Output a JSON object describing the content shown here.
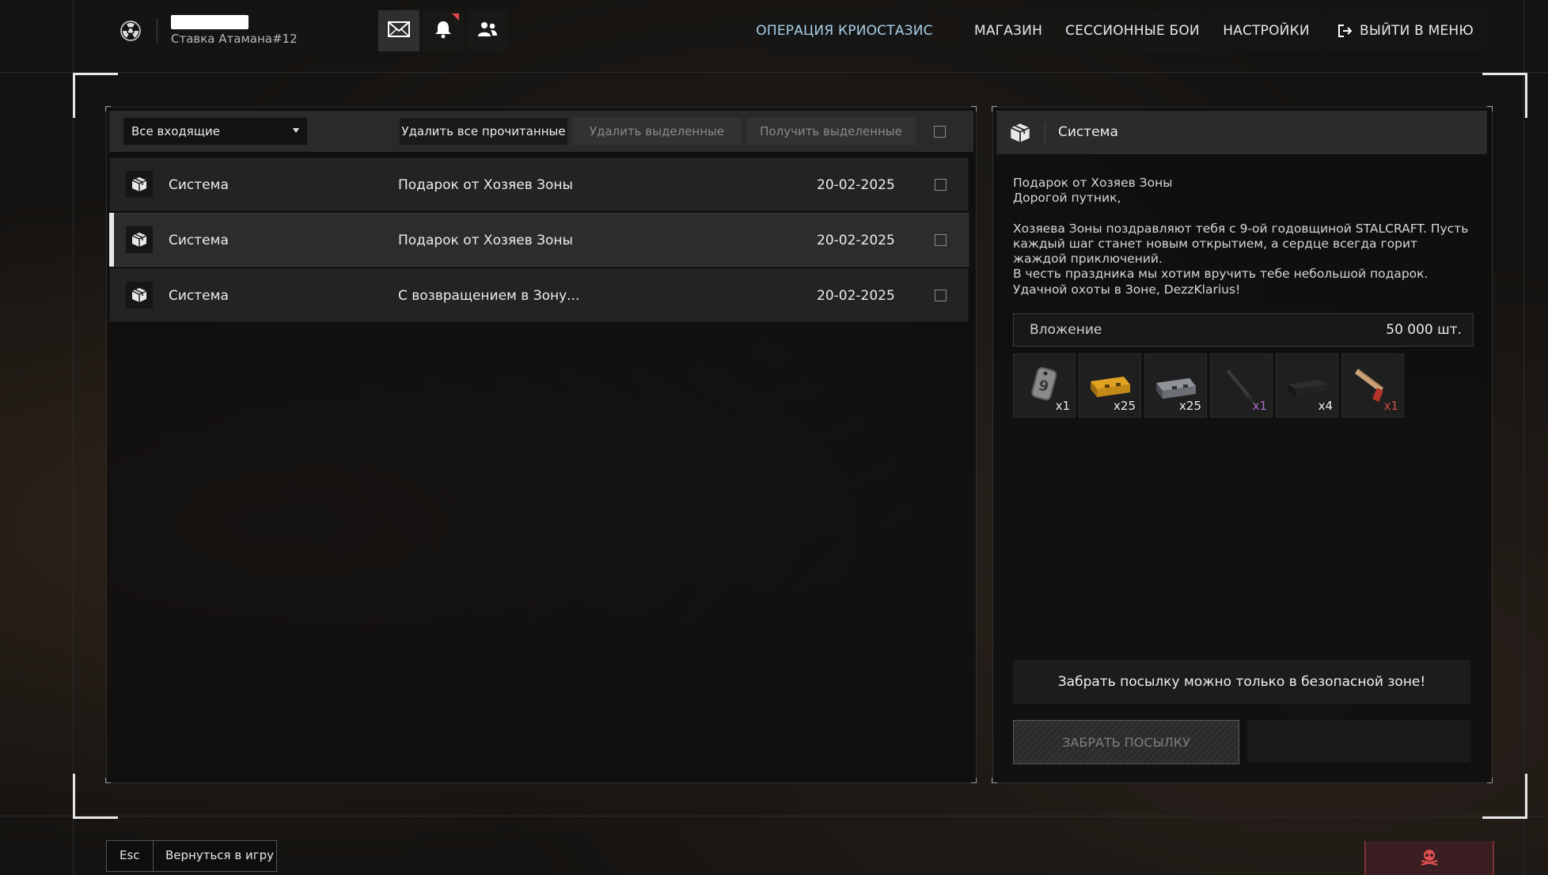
{
  "header": {
    "clan_tag": "Ставка Атамана#12",
    "icons": [
      "radiation-logo-icon",
      "mail-icon",
      "bell-icon",
      "friends-icon"
    ],
    "nav": [
      {
        "label": "ОПЕРАЦИЯ КРИОСТАЗИС",
        "active": true
      },
      {
        "label": "МАГАЗИН"
      },
      {
        "label": "СЕССИОННЫЕ БОИ"
      },
      {
        "label": "НАСТРОЙКИ"
      },
      {
        "label": "ВЫЙТИ В МЕНЮ",
        "icon": "exit-icon"
      }
    ]
  },
  "mail": {
    "filter_value": "Все входящие",
    "delete_read_label": "Удалить все прочитанные",
    "delete_selected_label": "Удалить выделенные",
    "receive_selected_label": "Получить выделенные",
    "rows": [
      {
        "sender": "Система",
        "subject": "Подарок от Хозяев Зоны",
        "date": "20-02-2025"
      },
      {
        "sender": "Система",
        "subject": "Подарок от Хозяев Зоны",
        "date": "20-02-2025",
        "selected": true
      },
      {
        "sender": "Система",
        "subject": "С возвращением в Зону...",
        "date": "20-02-2025"
      }
    ]
  },
  "message": {
    "sender": "Система",
    "title": "Подарок от Хозяев Зоны",
    "greeting": "Дорогой путник,",
    "para1": "Хозяева Зоны поздравляют тебя с 9-ой годовщиной STALCRAFT. Пусть каждый шаг станет новым открытием, а сердце всегда горит жаждой приключений.",
    "para2": "В честь праздника мы хотим вручить тебе небольшой подарок. Удачной охоты в Зоне, DezzKlarius!",
    "attachment_label": "Вложение",
    "attachment_value": "50 000 шт.",
    "items": [
      {
        "icon": "dogtag-icon",
        "count": "x1",
        "color": "#ececec"
      },
      {
        "icon": "gold-case-icon",
        "count": "x25",
        "color": "#ececec"
      },
      {
        "icon": "steel-case-icon",
        "count": "x25",
        "color": "#ececec"
      },
      {
        "icon": "knife-icon",
        "count": "x1",
        "color": "#b06ac8"
      },
      {
        "icon": "black-case-icon",
        "count": "x4",
        "color": "#ececec"
      },
      {
        "icon": "pistol-icon",
        "count": "x1",
        "color": "#d24a4a"
      }
    ],
    "notice": "Забрать посылку можно только в безопасной зоне!",
    "take_label": "ЗАБРАТЬ ПОСЫЛКУ"
  },
  "footer": {
    "esc_key": "Esc",
    "back_label": "Вернуться в игру",
    "right_icon": "skull-icon"
  },
  "colors": {
    "accent_nav": "#a7cfe6",
    "rare_purple": "#b06ac8",
    "rare_red": "#d24a4a"
  }
}
